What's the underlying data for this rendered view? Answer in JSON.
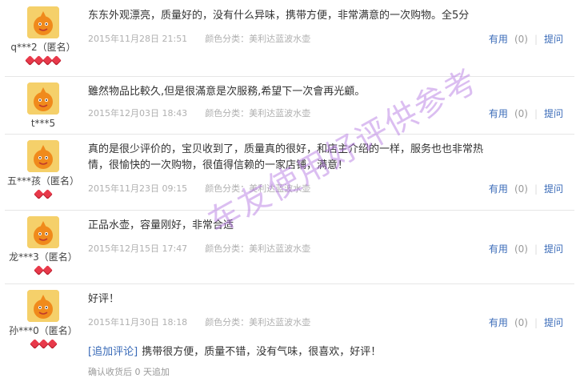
{
  "reviews": [
    {
      "user": "q***2（匿名）",
      "hearts": 4,
      "content": "东东外观漂亮，质量好的，没有什么异味，携带方便，非常满意的一次购物。全5分",
      "date": "2015年11月28日 21:51",
      "color_label": "颜色分类：美利达蓝波水壶",
      "useful_label": "有用",
      "useful_count": "(0)",
      "ask_label": "提问"
    },
    {
      "user": "t***5",
      "hearts": 0,
      "content": "雖然物品比較久,但是很滿意是次服務,希望下一次會再光顧。",
      "date": "2015年12月03日 18:43",
      "color_label": "颜色分类：美利达蓝波水壶",
      "useful_label": "有用",
      "useful_count": "(0)",
      "ask_label": "提问"
    },
    {
      "user": "五***孩（匿名）",
      "hearts": 2,
      "content": "真的是很少评价的，宝贝收到了，质量真的很好，和店主介绍的一样，服务也也非常热情，很愉快的一次购物，很值得信赖的一家店铺，满意！",
      "date": "2015年11月23日 09:15",
      "color_label": "颜色分类：美利达蓝波水壶",
      "useful_label": "有用",
      "useful_count": "(0)",
      "ask_label": "提问"
    },
    {
      "user": "龙***3（匿名）",
      "hearts": 2,
      "content": "正品水壶，容量刚好，非常合适",
      "date": "2015年12月15日 17:47",
      "color_label": "颜色分类：美利达蓝波水壶",
      "useful_label": "有用",
      "useful_count": "(0)",
      "ask_label": "提问"
    },
    {
      "user": "孙***0（匿名）",
      "hearts": 3,
      "content": "好评！",
      "date": "2015年11月30日 18:18",
      "color_label": "颜色分类：美利达蓝波水壶",
      "useful_label": "有用",
      "useful_count": "(0)",
      "ask_label": "提问",
      "append_label": "[追加评论]",
      "append_text": "携带很方便，质量不错，没有气味，很喜欢，好评！",
      "append_meta": "确认收货后 0 天追加"
    }
  ],
  "watermark": "车友使用好评供参考",
  "colors": {
    "link": "#3a6bb8",
    "meta": "#b0b0b0",
    "heart": "#e8394a",
    "watermark": "#af6ee1"
  }
}
